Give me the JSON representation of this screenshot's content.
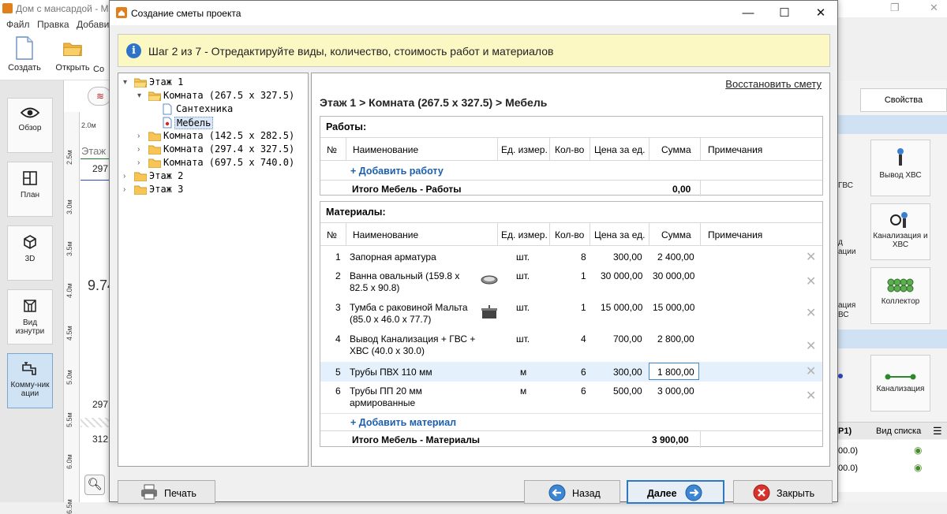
{
  "background_app": {
    "title": "Дом с мансардой - Мо",
    "menu": [
      "Файл",
      "Правка",
      "Добавит"
    ],
    "toolbar": {
      "create": "Создать",
      "open": "Открыть",
      "partial": "Со"
    },
    "left_nav": [
      "Обзор",
      "План",
      "3D",
      "Вид изнутри",
      "Комму-никации"
    ],
    "ruler_labels": [
      "2.5м",
      "3.0м",
      "3.5м",
      "4.0м",
      "4.5м",
      "5.0м",
      "5.5м",
      "6.0м",
      "6.5м"
    ],
    "ruler_top": "2.0м",
    "canvas_texts": {
      "etazh": "Этаж",
      "n297a": "297",
      "n974": "9.74",
      "n297b": "297",
      "n312": "312"
    },
    "right_panel": {
      "tab": "Свойства",
      "buttons": [
        "Вывод ХВС",
        "Канализация и ХВС",
        "Коллектор",
        "Канализация"
      ],
      "partial_labels": [
        "ГВС",
        "д",
        "ации",
        "ация",
        "ВС"
      ],
      "list_header": "Вид списка",
      "list_partial": "Р1)",
      "list_items": [
        "00.0)",
        "00.0)"
      ]
    }
  },
  "dialog": {
    "title": "Создание сметы проекта",
    "banner": "Шаг 2 из 7 - Отредактируйте виды, количество, стоимость работ и материалов",
    "tree": [
      {
        "label": "Этаж 1",
        "level": 0,
        "expanded": true
      },
      {
        "label": "Комната (267.5 x 327.5)",
        "level": 1,
        "expanded": true
      },
      {
        "label": "Сантехника",
        "level": 2,
        "leaf": true
      },
      {
        "label": "Мебель",
        "level": 2,
        "leaf": true,
        "selected": true
      },
      {
        "label": "Комната (142.5 x 282.5)",
        "level": 1,
        "expanded": false
      },
      {
        "label": "Комната (297.4 x 327.5)",
        "level": 1,
        "expanded": false
      },
      {
        "label": "Комната (697.5 x 740.0)",
        "level": 1,
        "expanded": false
      },
      {
        "label": "Этаж 2",
        "level": 0,
        "expanded": false
      },
      {
        "label": "Этаж 3",
        "level": 0,
        "expanded": false
      }
    ],
    "restore_link": "Восстановить смету",
    "breadcrumb": "Этаж 1 > Комната (267.5 x 327.5) > Мебель",
    "columns": [
      "№",
      "Наименование",
      "Ед. измер.",
      "Кол-во",
      "Цена за ед.",
      "Сумма",
      "Примечания"
    ],
    "works": {
      "title": "Работы:",
      "add_label": "+ Добавить работу",
      "total_label": "Итого Мебель - Работы",
      "total_value": "0,00"
    },
    "materials": {
      "title": "Материалы:",
      "add_label": "+ Добавить материал",
      "total_label": "Итого Мебель - Материалы",
      "total_value": "3 900,00",
      "rows": [
        {
          "num": "1",
          "name1": "Запорная арматура",
          "name2": "",
          "unit": "шт.",
          "qty": "8",
          "price": "300,00",
          "sum": "2 400,00",
          "icon": ""
        },
        {
          "num": "2",
          "name1": "Ванна овальный (159.8 x",
          "name2": "82.5 x 90.8)",
          "unit": "шт.",
          "qty": "1",
          "price": "30 000,00",
          "sum": "30 000,00",
          "icon": "bathtub-icon"
        },
        {
          "num": "3",
          "name1": "Тумба с раковиной Мальта",
          "name2": "(85.0 x 46.0 x 77.7)",
          "unit": "шт.",
          "qty": "1",
          "price": "15 000,00",
          "sum": "15 000,00",
          "icon": "vanity-icon"
        },
        {
          "num": "4",
          "name1": "Вывод Канализация + ГВС +",
          "name2": "ХВС (40.0 x 30.0)",
          "unit": "шт.",
          "qty": "4",
          "price": "700,00",
          "sum": "2 800,00",
          "icon": ""
        },
        {
          "num": "5",
          "name1": "Трубы ПВХ 110 мм",
          "name2": "",
          "unit": "м",
          "qty": "6",
          "price": "300,00",
          "sum": "1 800,00",
          "icon": "",
          "selected": true
        },
        {
          "num": "6",
          "name1": "Трубы ПП 20 мм",
          "name2": "армированные",
          "unit": "м",
          "qty": "6",
          "price": "500,00",
          "sum": "3 000,00",
          "icon": ""
        }
      ]
    },
    "footer": {
      "print": "Печать",
      "back": "Назад",
      "next": "Далее",
      "close": "Закрыть"
    }
  }
}
